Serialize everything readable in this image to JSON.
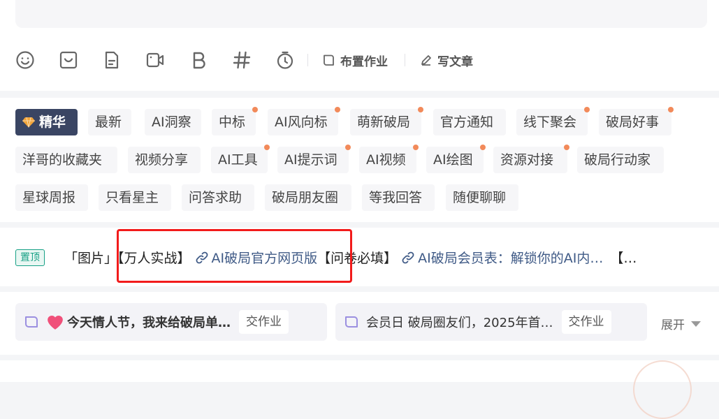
{
  "toolbar": {
    "icons": [
      "emoji-icon",
      "image-icon",
      "file-icon",
      "video-icon",
      "bold-icon",
      "hashtag-icon",
      "timer-icon"
    ],
    "assign_homework": "布置作业",
    "write_article": "写文章"
  },
  "tags": [
    {
      "label": "精华",
      "active": true
    },
    {
      "label": "最新"
    },
    {
      "label": "AI洞察"
    },
    {
      "label": "中标",
      "dot": true
    },
    {
      "label": "AI风向标",
      "dot": true
    },
    {
      "label": "萌新破局",
      "dot": true
    },
    {
      "label": "官方通知"
    },
    {
      "label": "线下聚会",
      "dot": true
    },
    {
      "label": "破局好事",
      "dot": true
    },
    {
      "label": "洋哥的收藏夹"
    },
    {
      "label": "视频分享"
    },
    {
      "label": "AI工具",
      "dot": true
    },
    {
      "label": "AI提示词",
      "dot": true
    },
    {
      "label": "AI视频",
      "dot": true
    },
    {
      "label": "AI绘图",
      "dot": true
    },
    {
      "label": "资源对接",
      "dot": true
    },
    {
      "label": "破局行动家"
    },
    {
      "label": "星球周报"
    },
    {
      "label": "只看星主"
    },
    {
      "label": "问答求助"
    },
    {
      "label": "破局朋友圈"
    },
    {
      "label": "等我回答"
    },
    {
      "label": "随便聊聊"
    }
  ],
  "pinned": {
    "badge": "置顶",
    "image_tag": "「图片」",
    "title1": "【万人实战】",
    "link1": "AI破局官方网页版",
    "title2": "【问卷必填】",
    "link2": "AI破局会员表：解锁你的AI内…",
    "trailing": "【…"
  },
  "homework": {
    "items": [
      {
        "text": "今天情人节，我来给破局单…",
        "button": "交作业"
      },
      {
        "text": "会员日 破局圈友们，2025年首…",
        "button": "交作业"
      }
    ],
    "expand": "展开"
  },
  "colors": {
    "active_tag": "#3a4563",
    "dot": "#f28a5a",
    "link": "#3f5a86",
    "pin_badge": "#16a085",
    "highlight_box": "#f21b1b",
    "book_icon": "#9b8fe0"
  }
}
